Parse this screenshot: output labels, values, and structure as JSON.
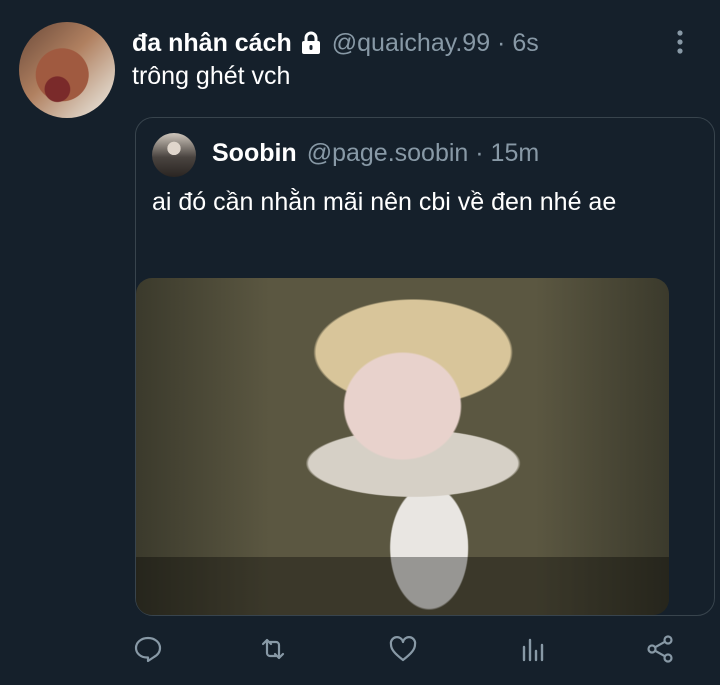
{
  "tweet": {
    "display_name": "đa nhân cách",
    "handle": "@quaichay.99",
    "time": "6s",
    "handle_line": "@quaichay.99 · 6s",
    "text": "trông ghét vch"
  },
  "quote": {
    "display_name": "Soobin",
    "handle_line": "@page.soobin · 15m",
    "text": "ai đó cần nhằn mãi nên cbi về đen nhé ae"
  },
  "colors": {
    "background": "#15202b",
    "secondary_text": "#8899a6",
    "border": "#38444d"
  },
  "icons": {
    "lock": "lock-icon",
    "more": "more-vertical-icon",
    "reply": "reply-icon",
    "retweet": "retweet-icon",
    "like": "heart-icon",
    "analytics": "analytics-icon",
    "share": "share-icon"
  }
}
